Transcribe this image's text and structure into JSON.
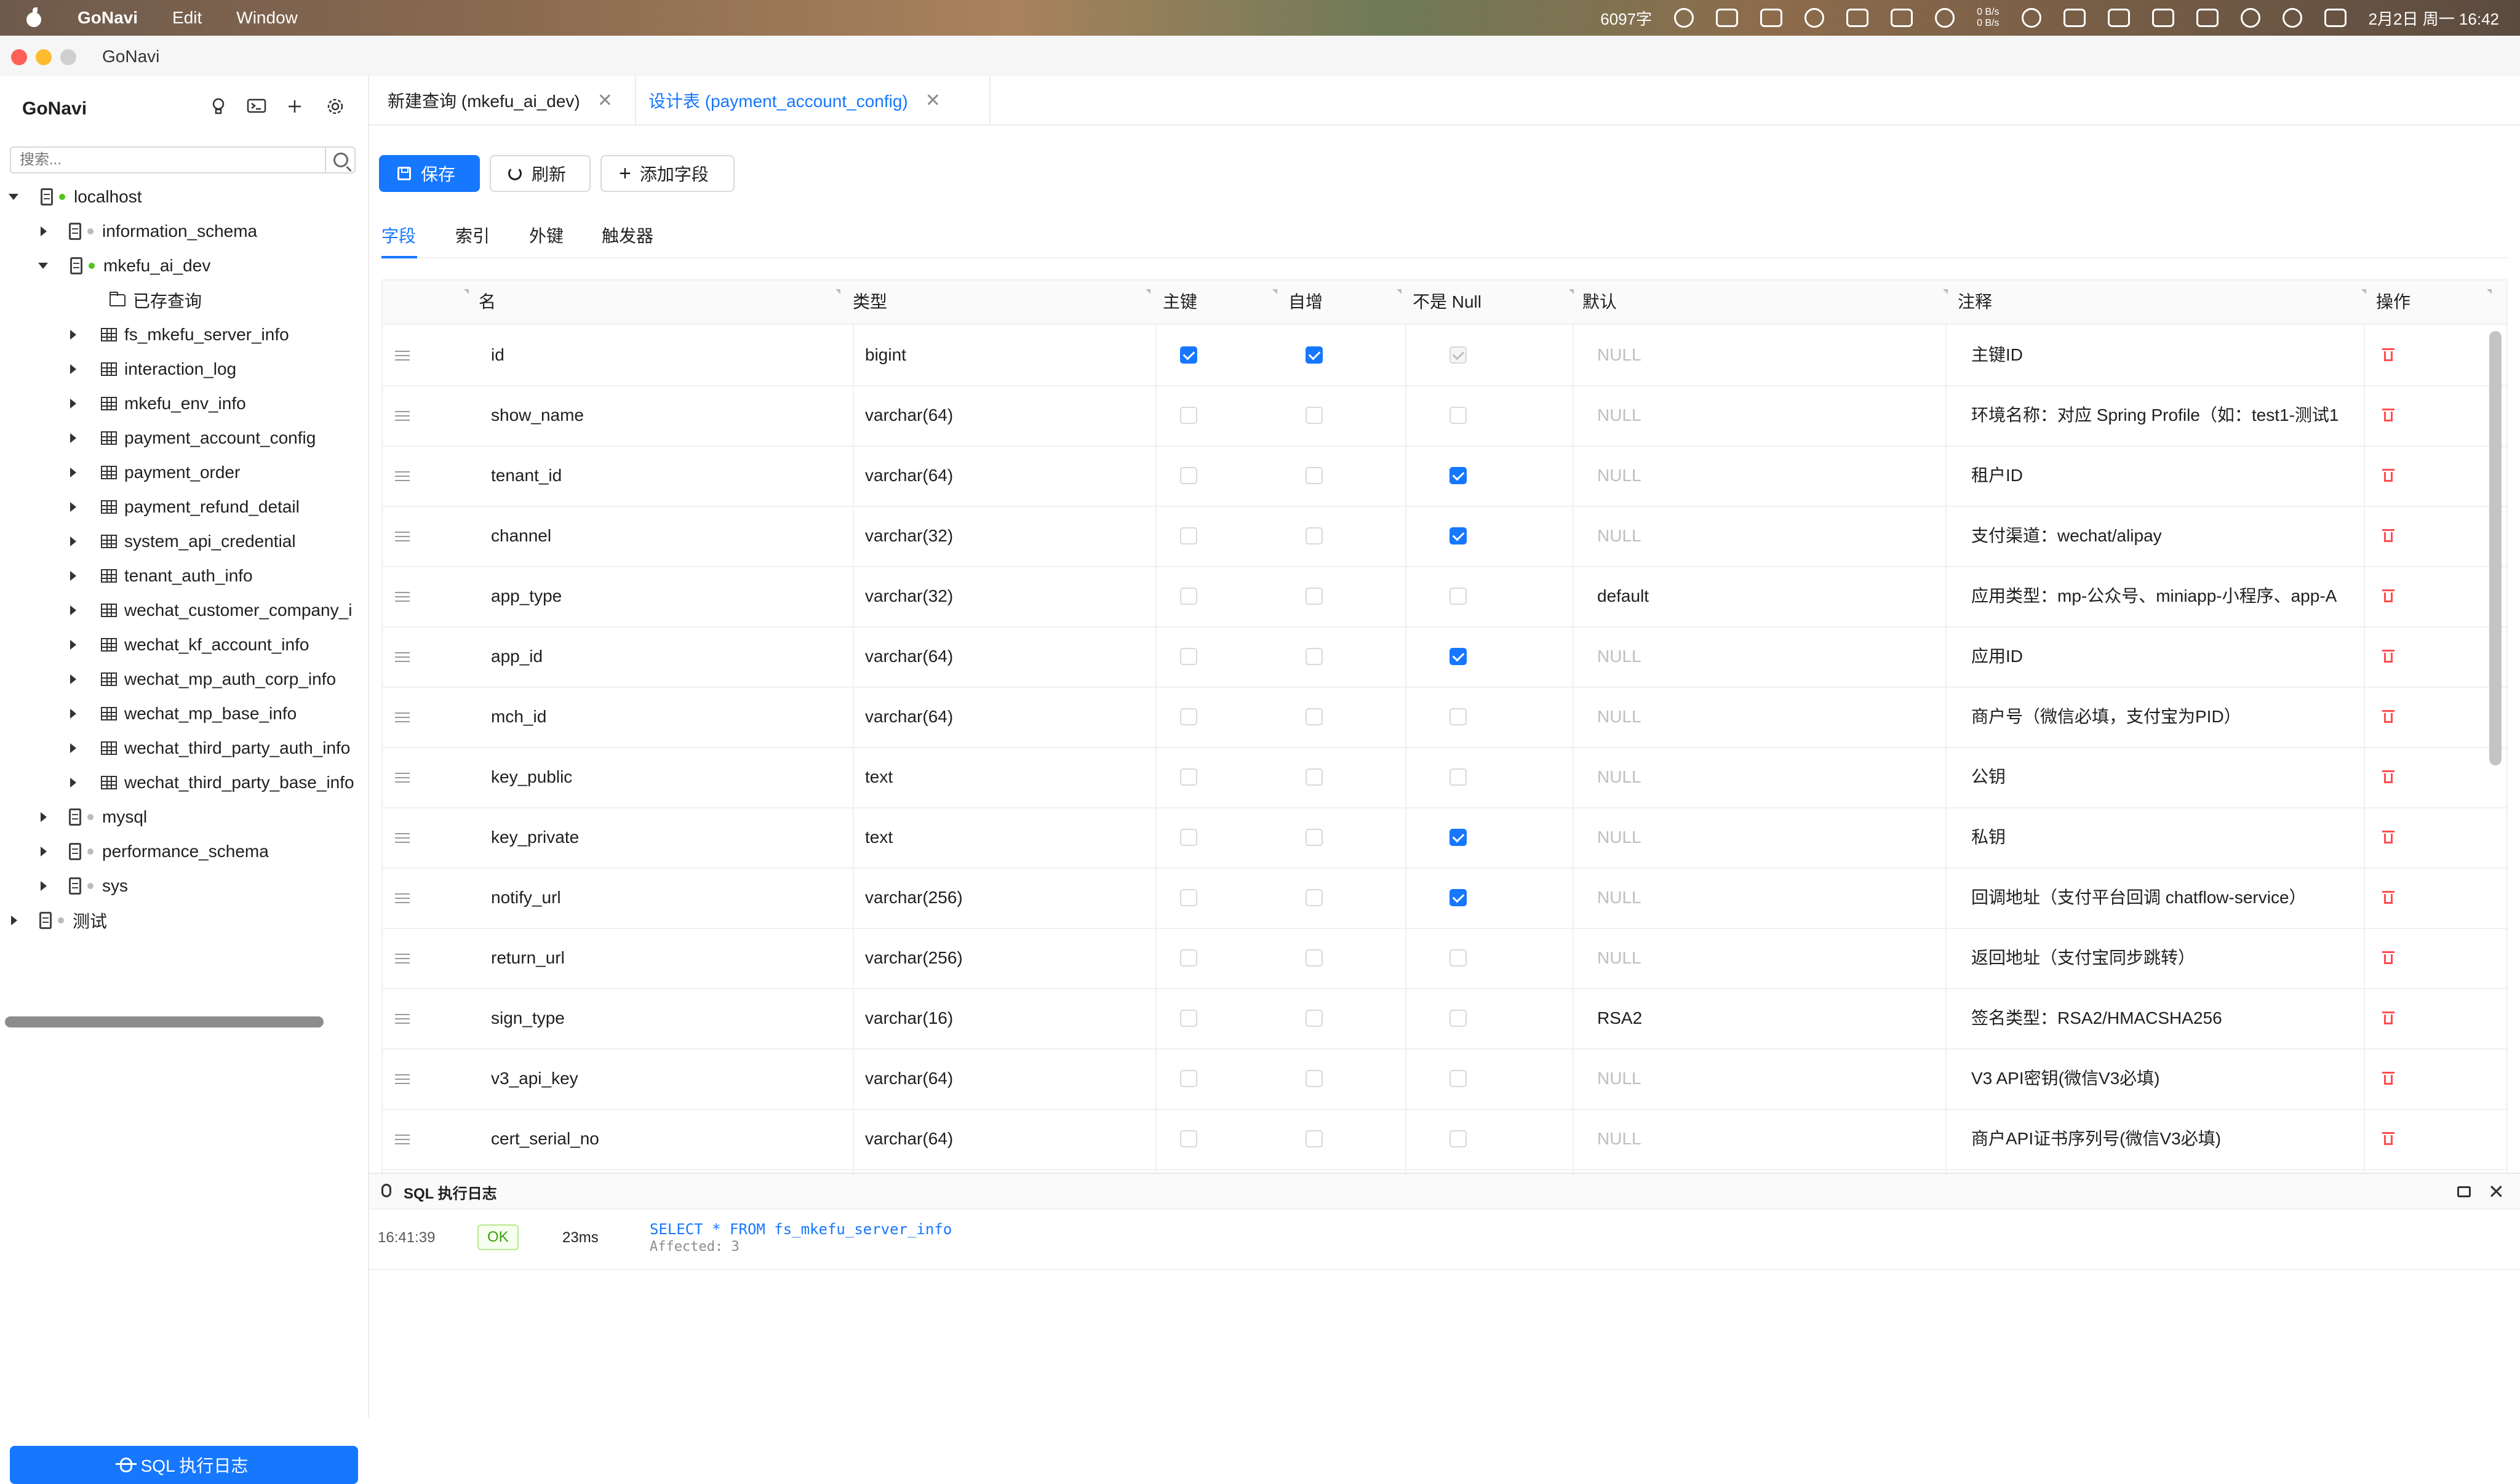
{
  "menubar": {
    "app_name": "GoNavi",
    "menus": [
      "Edit",
      "Window"
    ],
    "word_count": "6097字",
    "net_up": "0 B/s",
    "net_down": "0 B/s",
    "datetime": "2月2日 周一 16:42"
  },
  "window": {
    "title": "GoNavi"
  },
  "sidebar": {
    "title": "GoNavi",
    "search_placeholder": "搜索...",
    "tree": [
      {
        "label": "localhost",
        "kind": "connection",
        "expanded": true,
        "status": "connected"
      },
      {
        "label": "information_schema",
        "kind": "database",
        "expanded": false,
        "status": "idle"
      },
      {
        "label": "mkefu_ai_dev",
        "kind": "database",
        "expanded": true,
        "status": "connected"
      },
      {
        "label": "已存查询",
        "kind": "folder"
      },
      {
        "label": "fs_mkefu_server_info",
        "kind": "table"
      },
      {
        "label": "interaction_log",
        "kind": "table"
      },
      {
        "label": "mkefu_env_info",
        "kind": "table"
      },
      {
        "label": "payment_account_config",
        "kind": "table"
      },
      {
        "label": "payment_order",
        "kind": "table"
      },
      {
        "label": "payment_refund_detail",
        "kind": "table"
      },
      {
        "label": "system_api_credential",
        "kind": "table"
      },
      {
        "label": "tenant_auth_info",
        "kind": "table"
      },
      {
        "label": "wechat_customer_company_i",
        "kind": "table"
      },
      {
        "label": "wechat_kf_account_info",
        "kind": "table"
      },
      {
        "label": "wechat_mp_auth_corp_info",
        "kind": "table"
      },
      {
        "label": "wechat_mp_base_info",
        "kind": "table"
      },
      {
        "label": "wechat_third_party_auth_info",
        "kind": "table"
      },
      {
        "label": "wechat_third_party_base_info",
        "kind": "table"
      },
      {
        "label": "mysql",
        "kind": "database",
        "expanded": false,
        "status": "idle"
      },
      {
        "label": "performance_schema",
        "kind": "database",
        "expanded": false,
        "status": "idle"
      },
      {
        "label": "sys",
        "kind": "database",
        "expanded": false,
        "status": "idle"
      },
      {
        "label": "测试",
        "kind": "connection",
        "expanded": false,
        "status": "idle"
      }
    ],
    "log_button": "SQL 执行日志"
  },
  "tabs": [
    {
      "label": "新建查询 (mkefu_ai_dev)",
      "active": false
    },
    {
      "label": "设计表 (payment_account_config)",
      "active": true
    }
  ],
  "toolbar": {
    "save": "保存",
    "refresh": "刷新",
    "add_field": "添加字段"
  },
  "subtabs": [
    "字段",
    "索引",
    "外键",
    "触发器"
  ],
  "grid": {
    "headers": {
      "name": "名",
      "type": "类型",
      "pk": "主键",
      "auto": "自增",
      "notnull": "不是 Null",
      "default": "默认",
      "comment": "注释",
      "action": "操作"
    },
    "rows": [
      {
        "name": "id",
        "type": "bigint",
        "pk": true,
        "auto": true,
        "notnull": "locked",
        "default": "NULL",
        "comment": "主键ID"
      },
      {
        "name": "show_name",
        "type": "varchar(64)",
        "pk": false,
        "auto": false,
        "notnull": false,
        "default": "NULL",
        "comment": "环境名称：对应 Spring Profile（如：test1-测试1"
      },
      {
        "name": "tenant_id",
        "type": "varchar(64)",
        "pk": false,
        "auto": false,
        "notnull": true,
        "default": "NULL",
        "comment": "租户ID"
      },
      {
        "name": "channel",
        "type": "varchar(32)",
        "pk": false,
        "auto": false,
        "notnull": true,
        "default": "NULL",
        "comment": "支付渠道：wechat/alipay"
      },
      {
        "name": "app_type",
        "type": "varchar(32)",
        "pk": false,
        "auto": false,
        "notnull": false,
        "default": "default",
        "comment": "应用类型：mp-公众号、miniapp-小程序、app-A"
      },
      {
        "name": "app_id",
        "type": "varchar(64)",
        "pk": false,
        "auto": false,
        "notnull": true,
        "default": "NULL",
        "comment": "应用ID"
      },
      {
        "name": "mch_id",
        "type": "varchar(64)",
        "pk": false,
        "auto": false,
        "notnull": false,
        "default": "NULL",
        "comment": "商户号（微信必填，支付宝为PID）"
      },
      {
        "name": "key_public",
        "type": "text",
        "pk": false,
        "auto": false,
        "notnull": false,
        "default": "NULL",
        "comment": "公钥"
      },
      {
        "name": "key_private",
        "type": "text",
        "pk": false,
        "auto": false,
        "notnull": true,
        "default": "NULL",
        "comment": "私钥"
      },
      {
        "name": "notify_url",
        "type": "varchar(256)",
        "pk": false,
        "auto": false,
        "notnull": true,
        "default": "NULL",
        "comment": "回调地址（支付平台回调 chatflow-service）"
      },
      {
        "name": "return_url",
        "type": "varchar(256)",
        "pk": false,
        "auto": false,
        "notnull": false,
        "default": "NULL",
        "comment": "返回地址（支付宝同步跳转）"
      },
      {
        "name": "sign_type",
        "type": "varchar(16)",
        "pk": false,
        "auto": false,
        "notnull": false,
        "default": "RSA2",
        "comment": "签名类型：RSA2/HMACSHA256"
      },
      {
        "name": "v3_api_key",
        "type": "varchar(64)",
        "pk": false,
        "auto": false,
        "notnull": false,
        "default": "NULL",
        "comment": "V3 API密钥(微信V3必填)"
      },
      {
        "name": "cert_serial_no",
        "type": "varchar(64)",
        "pk": false,
        "auto": false,
        "notnull": false,
        "default": "NULL",
        "comment": "商户API证书序列号(微信V3必填)"
      }
    ]
  },
  "log": {
    "title": "SQL 执行日志",
    "entries": [
      {
        "time": "16:41:39",
        "status": "OK",
        "duration": "23ms",
        "sql": "SELECT * FROM fs_mkefu_server_info",
        "affected": "Affected: 3"
      }
    ]
  },
  "colors": {
    "accent": "#1677ff",
    "ok": "#389e0d",
    "danger": "#ff4d4f"
  }
}
